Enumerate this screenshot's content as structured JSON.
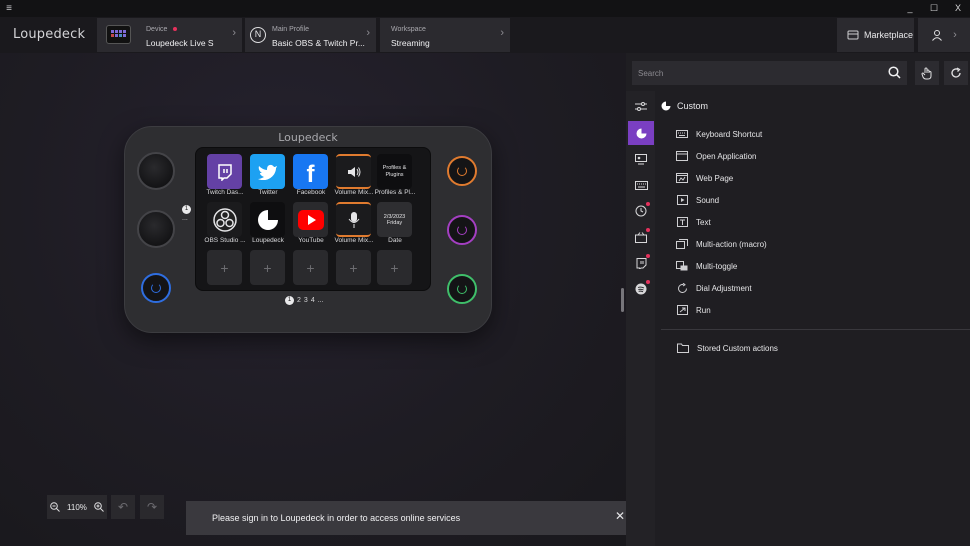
{
  "titlebar": {
    "menu_icon": "hamburger-icon",
    "window_buttons": [
      "_",
      "☐",
      "X"
    ]
  },
  "app": {
    "logo": "Loupedeck"
  },
  "breadcrumbs": [
    {
      "small": "Device",
      "value": "Loupedeck Live S",
      "status_color": "#e5315c"
    },
    {
      "small": "Main Profile",
      "value": "Basic OBS & Twitch Pr..."
    },
    {
      "small": "Workspace",
      "value": "Streaming"
    }
  ],
  "marketplace": {
    "label": "Marketplace"
  },
  "device": {
    "logo": "Loupedeck",
    "keys": [
      {
        "label": "Twitch Das...",
        "icon": "twitch-icon"
      },
      {
        "label": "Twitter",
        "icon": "twitter-icon"
      },
      {
        "label": "Facebook",
        "icon": "facebook-icon"
      },
      {
        "label": "Volume Mix...",
        "icon": "speaker-icon"
      },
      {
        "label": "Profiles & Pl...",
        "icon": "profiles-icon",
        "inner_text": "Profiles & Plugins"
      },
      {
        "label": "OBS Studio ...",
        "icon": "obs-icon"
      },
      {
        "label": "Loupedeck",
        "icon": "loupedeck-icon"
      },
      {
        "label": "YouTube",
        "icon": "youtube-icon"
      },
      {
        "label": "Volume Mix...",
        "icon": "microphone-icon"
      },
      {
        "label": "Date",
        "icon": "date-icon",
        "inner_date": "2/3/2023",
        "inner_day": "Friday"
      }
    ],
    "empty_key_symbol": "+",
    "pages": [
      "1",
      "2",
      "3",
      "4",
      "..."
    ],
    "side_badge": "1",
    "side_dots": "...",
    "button_colors": {
      "left": "#2f6ee0",
      "right_top": "#e07b2f",
      "right_mid": "#a43fc2",
      "right_bottom": "#3fbf6a"
    }
  },
  "canvas_controls": {
    "zoom": "110%"
  },
  "toast": {
    "message": "Please sign in to Loupedeck in order to access online services",
    "close": "✕"
  },
  "right_panel": {
    "search_placeholder": "Search",
    "category": "Custom",
    "actions": [
      "Keyboard Shortcut",
      "Open Application",
      "Web Page",
      "Sound",
      "Text",
      "Multi-action (macro)",
      "Multi-toggle",
      "Dial Adjustment",
      "Run"
    ],
    "stored": "Stored Custom actions"
  },
  "colors": {
    "accent": "#7a3fc2",
    "alert": "#e5315c"
  }
}
